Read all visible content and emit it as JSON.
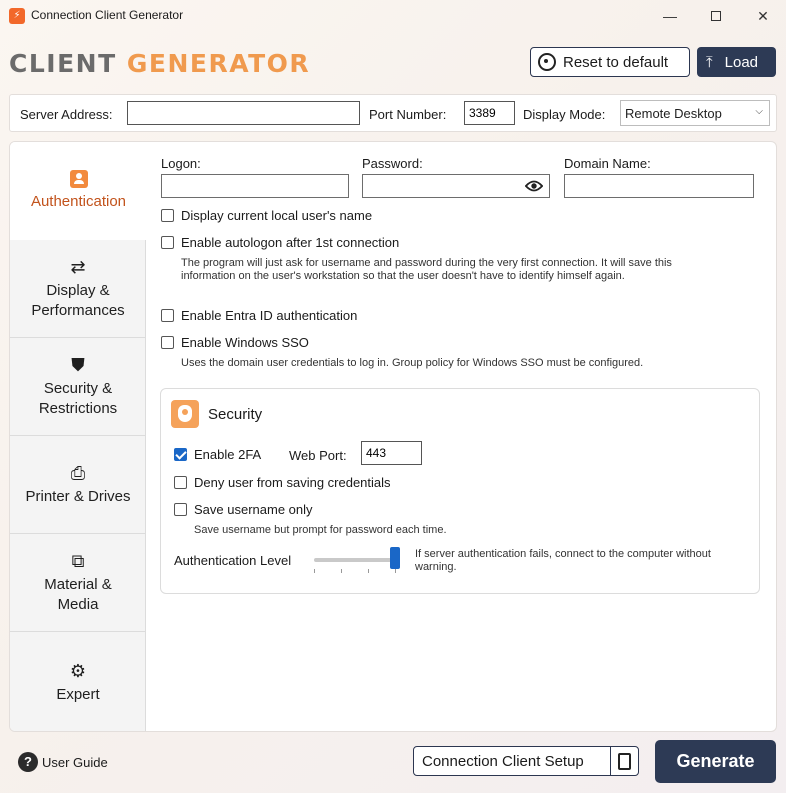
{
  "window": {
    "title": "Connection Client Generator",
    "minimize_glyph": "—",
    "close_glyph": "✕"
  },
  "brand": {
    "part1": "CLIENT ",
    "part2": "GENERATOR"
  },
  "header": {
    "reset_label": "Reset to default",
    "load_label": "Load",
    "load_icon": "⤒"
  },
  "server": {
    "address_label": "Server Address:",
    "address_value": "",
    "port_label": "Port Number:",
    "port_value": "3389",
    "display_mode_label": "Display Mode:",
    "display_mode_value": "Remote Desktop"
  },
  "sidebar": {
    "items": [
      {
        "label": "Authentication",
        "icon": "user-badge-icon"
      },
      {
        "label": "Display & Performances",
        "icon": "display-settings-icon",
        "glyph": "⇄"
      },
      {
        "label": "Security & Restrictions",
        "icon": "shield-icon",
        "glyph": "⛊"
      },
      {
        "label": "Printer & Drives",
        "icon": "printer-icon",
        "glyph": "⎙"
      },
      {
        "label": "Material & Media",
        "icon": "media-cable-icon",
        "glyph": "⧉"
      },
      {
        "label": "Expert",
        "icon": "expert-gear-icon",
        "glyph": "⚙"
      }
    ]
  },
  "auth": {
    "logon_label": "Logon:",
    "logon_value": "",
    "password_label": "Password:",
    "password_value": "",
    "domain_label": "Domain Name:",
    "domain_value": "",
    "display_local_user": {
      "label": "Display current local user's name",
      "checked": false
    },
    "autologon": {
      "label": "Enable autologon after 1st connection",
      "checked": false,
      "note_line1": "The program will just ask for username and password during the very first connection. It will save this",
      "note_line2": "information on the user's workstation so that the user doesn't have to identify himself again."
    },
    "entra_id": {
      "label": "Enable Entra ID authentication",
      "checked": false
    },
    "windows_sso": {
      "label": "Enable Windows SSO",
      "checked": false,
      "note": "Uses the domain user credentials to log in. Group policy for Windows SSO must be configured."
    }
  },
  "security": {
    "title": "Security",
    "enable_2fa": {
      "label": "Enable 2FA",
      "checked": true
    },
    "web_port_label": "Web Port:",
    "web_port_value": "443",
    "deny_saving": {
      "label": "Deny user from saving credentials",
      "checked": false
    },
    "save_username": {
      "label": "Save username only",
      "checked": false,
      "note": "Save username but prompt for password each time."
    },
    "auth_level_label": "Authentication Level",
    "auth_level_value": 3,
    "auth_level_max": 3,
    "auth_level_desc_line1": "If server authentication fails, connect to the computer without",
    "auth_level_desc_line2": "warning."
  },
  "footer": {
    "help_glyph": "?",
    "user_guide_label": "User Guide",
    "setup_label": "Connection Client Setup",
    "generate_label": "Generate"
  },
  "colors": {
    "accent": "#f28a3d",
    "navy": "#2d3a55",
    "checkbox_blue": "#1a67c7"
  }
}
